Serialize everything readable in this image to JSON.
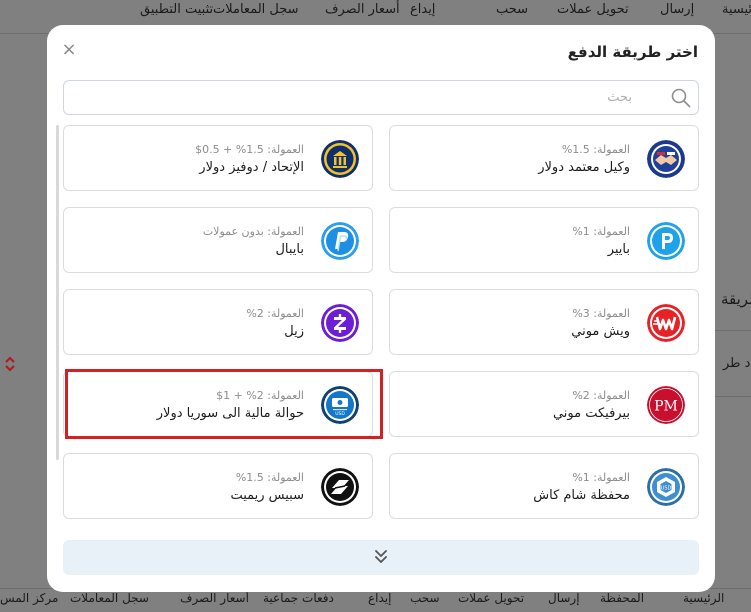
{
  "top_nav": [
    "تثبيت التطبيق",
    "سجل المعاملات",
    "أسعار الصرف",
    "إيداع",
    "سحب",
    "تحويل عملات",
    "إرسال",
    "الرئيسية"
  ],
  "bottom_nav": [
    "الرئيسية",
    "المحفظة",
    "إرسال",
    "تحويل عملات",
    "سحب",
    "إيداع",
    "دفعات جماعية",
    "أسعار الصرف",
    "سجل المعاملات",
    "مركز المس"
  ],
  "background": {
    "text_1": "طريقة",
    "text_2": "حدد طر"
  },
  "modal": {
    "title": "اختر طريقة الدفع",
    "close": "×",
    "search_placeholder": "بحث",
    "payment_methods": [
      {
        "name": "وكيل معتمد دولار",
        "fee": "العمولة: 1.5%",
        "icon": "handshake-icon"
      },
      {
        "name": "الإتحاد / دوفيز دولار",
        "fee": "العمولة: 1.5% + 0.5$",
        "icon": "bank-icon"
      },
      {
        "name": "بايير",
        "fee": "العمولة: 1%",
        "icon": "payeer-icon"
      },
      {
        "name": "بايبال",
        "fee": "العمولة: بدون عمولات",
        "icon": "paypal-icon"
      },
      {
        "name": "ويش موني",
        "fee": "العمولة: 3%",
        "icon": "wish-money-icon"
      },
      {
        "name": "زيل",
        "fee": "العمولة: 2%",
        "icon": "zelle-icon"
      },
      {
        "name": "بيرفيكت موني",
        "fee": "العمولة: 2%",
        "icon": "perfect-money-icon"
      },
      {
        "name": "حوالة مالية الى سوريا دولار",
        "fee": "العمولة: 2% + 1$",
        "icon": "money-transfer-icon"
      },
      {
        "name": "محفظة شام كاش",
        "fee": "العمولة: 1%",
        "icon": "sham-cash-icon"
      },
      {
        "name": "سبيس ريميت",
        "fee": "العمولة: 1.5%",
        "icon": "spaceremit-icon"
      }
    ]
  }
}
